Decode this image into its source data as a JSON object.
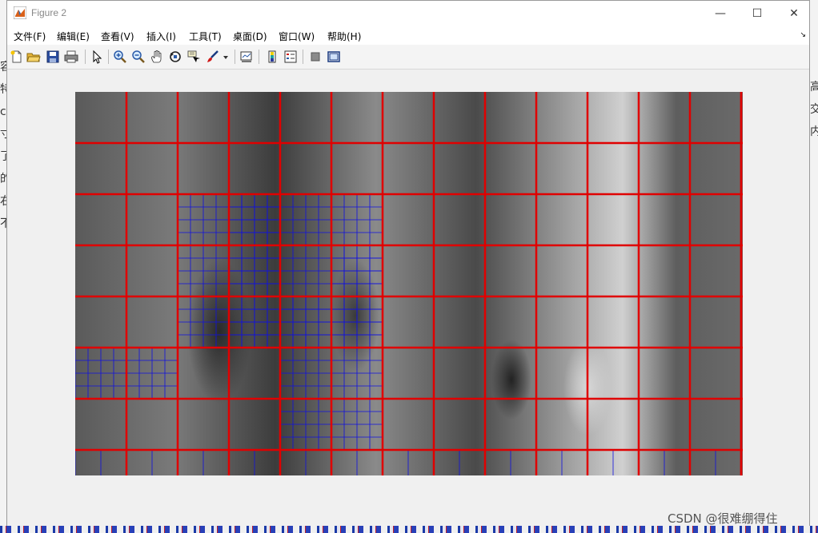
{
  "window": {
    "title": "Figure 2",
    "controls": {
      "minimize": "—",
      "maximize": "☐",
      "close": "✕"
    }
  },
  "menubar": {
    "items": [
      "文件(F)",
      "编辑(E)",
      "查看(V)",
      "插入(I)",
      "工具(T)",
      "桌面(D)",
      "窗口(W)",
      "帮助(H)"
    ],
    "overflow_arrow": "↘"
  },
  "toolbar": {
    "buttons": [
      "new-figure-icon",
      "open-file-icon",
      "save-icon",
      "print-icon",
      "edit-plot-arrow-icon",
      "zoom-in-icon",
      "zoom-out-icon",
      "pan-hand-icon",
      "rotate-3d-icon",
      "data-cursor-icon",
      "brush-icon",
      "brush-dropdown-icon",
      "link-plot-icon",
      "insert-colorbar-icon",
      "insert-legend-icon",
      "hide-plot-tools-icon",
      "show-plot-tools-icon"
    ]
  },
  "figure": {
    "image_description": "grayscale street photo with grid overlay",
    "grid_major_color": "#e00000",
    "grid_minor_color": "#1010e0"
  },
  "background": {
    "left_chars": [
      "容",
      "特",
      "c",
      "寸",
      "了",
      "的",
      "右",
      "不"
    ],
    "right_chars": [
      "高",
      "",
      "",
      "交",
      "内"
    ]
  },
  "watermark": "CSDN @很难绷得住"
}
